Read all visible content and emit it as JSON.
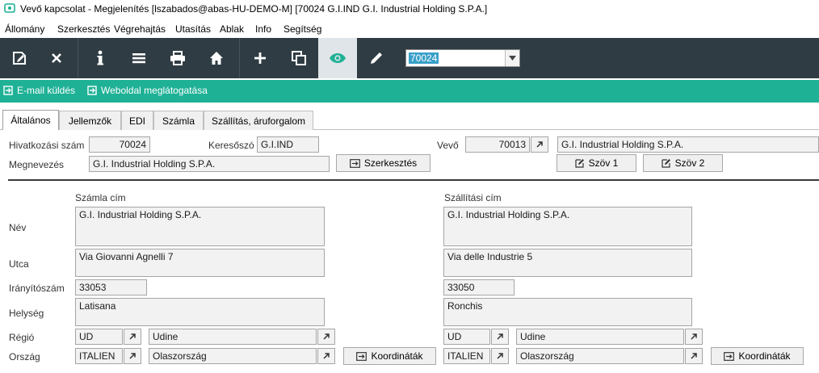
{
  "window": {
    "title": "Vevő kapcsolat - Megjelenítés  [lszabados@abas-HU-DEMO-M]  [70024    G.I.IND    G.I. Industrial Holding S.P.A.]"
  },
  "menu": {
    "items": [
      {
        "label": "Állomány"
      },
      {
        "label": "Szerkesztés"
      },
      {
        "label": "Végrehajtás"
      },
      {
        "label": "Utasítás"
      },
      {
        "label": "Ablak"
      },
      {
        "label": "Info"
      },
      {
        "label": "Segítség"
      }
    ]
  },
  "toolbar": {
    "buttons": [
      {
        "icon": "save-edit-icon"
      },
      {
        "icon": "close-icon"
      },
      {
        "icon": "info-icon"
      },
      {
        "icon": "list-icon"
      },
      {
        "icon": "print-icon"
      },
      {
        "icon": "home-icon"
      },
      {
        "icon": "plus-icon"
      },
      {
        "icon": "copy-icon"
      },
      {
        "icon": "eye-icon",
        "active": true
      },
      {
        "icon": "pencil-icon"
      }
    ],
    "record_combo": {
      "value": "70024"
    }
  },
  "actions": {
    "email": "E-mail küldés",
    "website": "Weboldal meglátogatása"
  },
  "tabs": [
    {
      "label": "Általános",
      "active": true
    },
    {
      "label": "Jellemzők"
    },
    {
      "label": "EDI"
    },
    {
      "label": "Számla"
    },
    {
      "label": "Szállítás, áruforgalom"
    }
  ],
  "header": {
    "ref_label": "Hivatkozási szám",
    "ref_value": "70024",
    "search_label": "Keresőszó",
    "search_value": "G.I.IND",
    "customer_label": "Vevő",
    "customer_no": "70013",
    "customer_name": "G.I. Industrial Holding S.P.A.",
    "name_label": "Megnevezés",
    "name_value": "G.I. Industrial Holding S.P.A.",
    "edit_button": "Szerkesztés",
    "text1_button": "Szöv 1",
    "text2_button": "Szöv 2"
  },
  "address": {
    "labels": {
      "name": "Név",
      "street": "Utca",
      "zip": "Irányítószám",
      "city": "Helység",
      "region": "Régió",
      "country": "Ország"
    },
    "billing": {
      "heading": "Számla cím",
      "name": "G.I. Industrial Holding S.P.A.",
      "street": "Via Giovanni Agnelli 7",
      "zip": "33053",
      "city": "Latisana",
      "region_code": "UD",
      "region_name": "Udine",
      "country_code": "ITALIEN",
      "country_name": "Olaszország",
      "coords_button": "Koordináták"
    },
    "shipping": {
      "heading": "Szállítási cím",
      "name": "G.I. Industrial Holding S.P.A.",
      "street": "Via delle Industrie 5",
      "zip": "33050",
      "city": "Ronchis",
      "region_code": "UD",
      "region_name": "Udine",
      "country_code": "ITALIEN",
      "country_name": "Olaszország",
      "coords_button": "Koordináták"
    }
  },
  "colors": {
    "toolbar_bg": "#2f3c43",
    "action_bar": "#1fb196",
    "selection": "#39a0c8"
  }
}
